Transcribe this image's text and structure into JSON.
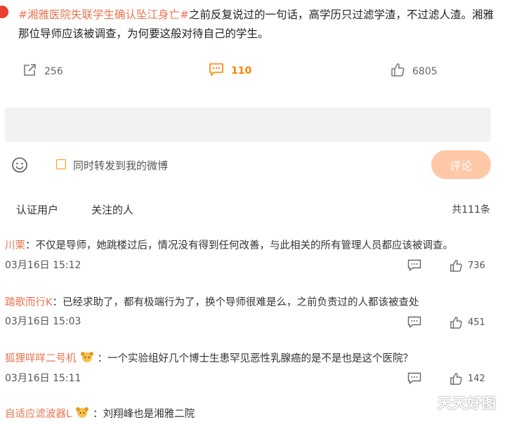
{
  "post": {
    "tag": "#湘雅医院失联学生确认坠江身亡#",
    "text": "之前反复说过的一句话，高学历只过滤学渣，不过滤人渣。湘雅那位导师应该被调查，为何要这般对待自己的学生。"
  },
  "actions": {
    "forward_count": "256",
    "comment_count": "110",
    "like_count": "6805"
  },
  "composer": {
    "placeholder": "",
    "forward_label": "同时转发到我的微博",
    "submit_label": "评论"
  },
  "tabs": {
    "verified": "认证用户",
    "following": "关注的人",
    "total": "共111条"
  },
  "comments": [
    {
      "user": "川栗",
      "sep": "：",
      "text": "不仅是导师，她跳楼过后，情况没有得到任何改善，与此相关的所有管理人员都应该被调查。",
      "time": "03月16日 15:12",
      "likes": "736"
    },
    {
      "user": "踏歌而行K",
      "sep": "：",
      "text": "已经求助了，都有极端行为了，换个导师很难是么，之前负责过的人都该被查处",
      "time": "03月16日 15:03",
      "likes": "451"
    },
    {
      "user": "狐狸咩咩二号机",
      "sep": "：",
      "text": "一个实验组好几个博士生患罕见恶性乳腺癌的是不是也是这个医院？",
      "time": "03月16日 15:11",
      "likes": "142"
    },
    {
      "user": "自适应滤波器L",
      "sep": "：",
      "text": "刘翔峰也是湘雅二院",
      "time": "",
      "likes": ""
    }
  ],
  "watermark": "天天好图",
  "colors": {
    "link": "#eb7350",
    "accent": "#ff8200",
    "submit_bg": "#ffc8a6",
    "input_bg": "#f2f2f5"
  }
}
